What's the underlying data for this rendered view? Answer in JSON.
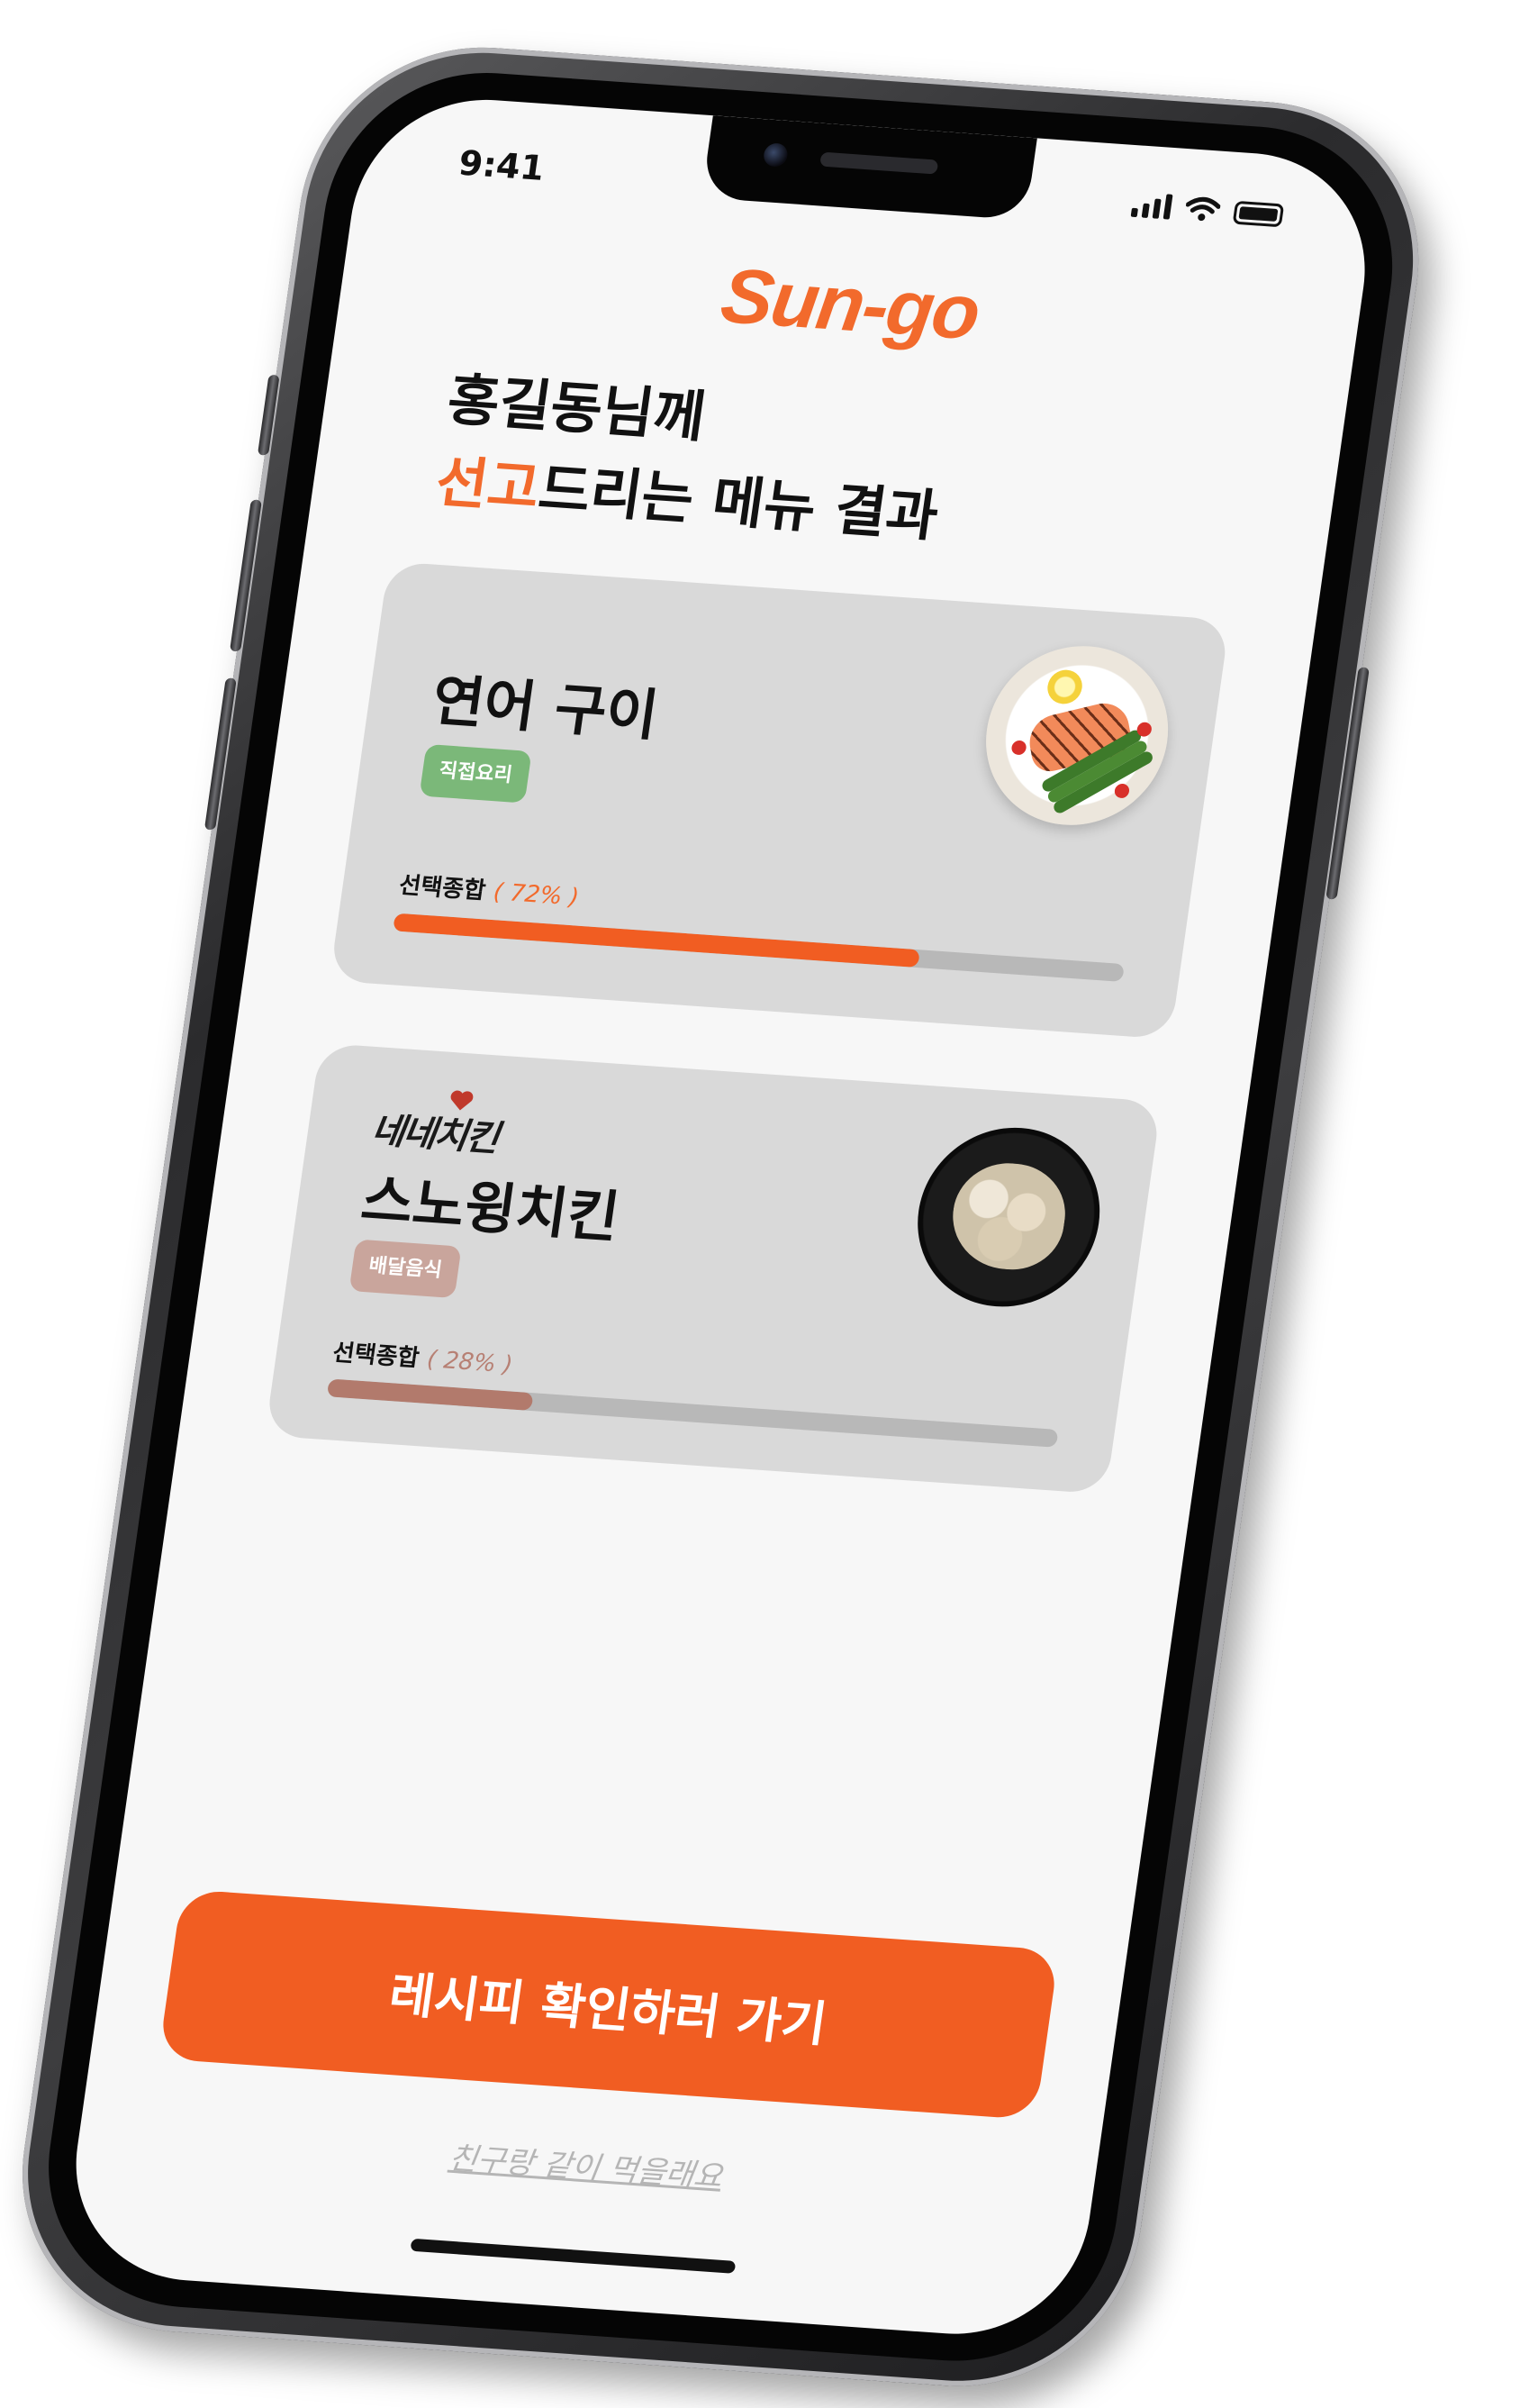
{
  "status_bar": {
    "time": "9:41"
  },
  "app": {
    "logo_text": "Sun-go"
  },
  "headline": {
    "line1": "홍길동님께",
    "line2_accent": "선고",
    "line2_rest": "드리는 메뉴 결과"
  },
  "results": [
    {
      "name": "연어 구이",
      "tag": "직접요리",
      "score_label": "선택종합",
      "score_text": "( 72% )",
      "score_percent": 72,
      "dish_icon": "grilled-salmon-plate",
      "colors": {
        "tag": "#7bb879",
        "bar": "#f15d22"
      }
    },
    {
      "brand": "네네치킨",
      "name": "스노윙치킨",
      "tag": "배달음식",
      "score_label": "선택종합",
      "score_text": "( 28% )",
      "score_percent": 28,
      "dish_icon": "snowing-chicken-plate",
      "colors": {
        "tag": "#c9a59c",
        "bar": "#b27a6c"
      }
    }
  ],
  "cta": {
    "label": "레시피 확인하러 가기"
  },
  "secondary_link": {
    "label": "친구랑 같이 먹을래요"
  },
  "colors": {
    "accent": "#f26a2c",
    "screen_bg": "#f7f7f7",
    "card_bg": "#d9d9d9"
  }
}
